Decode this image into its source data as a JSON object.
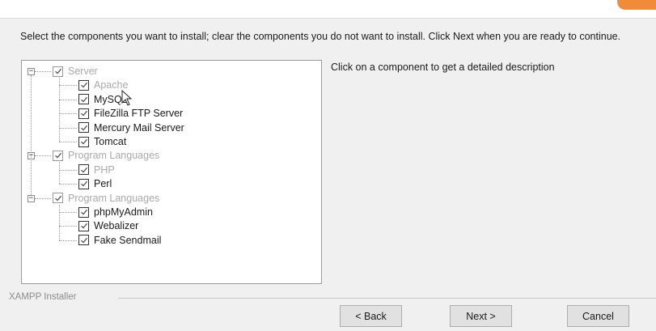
{
  "instructions": "Select the components you want to install; clear the components you do not want to install. Click Next when you are ready to continue.",
  "description": "Click on a component to get a detailed description",
  "tree": [
    {
      "label": "Server",
      "checked": true,
      "dimmed": true,
      "children": [
        {
          "label": "Apache",
          "checked": true,
          "dimmed": true
        },
        {
          "label": "MySQL",
          "checked": true,
          "dimmed": false
        },
        {
          "label": "FileZilla FTP Server",
          "checked": true,
          "dimmed": false
        },
        {
          "label": "Mercury Mail Server",
          "checked": true,
          "dimmed": false
        },
        {
          "label": "Tomcat",
          "checked": true,
          "dimmed": false
        }
      ]
    },
    {
      "label": "Program Languages",
      "checked": true,
      "dimmed": true,
      "children": [
        {
          "label": "PHP",
          "checked": true,
          "dimmed": true
        },
        {
          "label": "Perl",
          "checked": true,
          "dimmed": false
        }
      ]
    },
    {
      "label": "Program Languages",
      "checked": true,
      "dimmed": true,
      "children": [
        {
          "label": "phpMyAdmin",
          "checked": true,
          "dimmed": false
        },
        {
          "label": "Webalizer",
          "checked": true,
          "dimmed": false
        },
        {
          "label": "Fake Sendmail",
          "checked": true,
          "dimmed": false
        }
      ]
    }
  ],
  "footer": {
    "brand": "XAMPP Installer",
    "back_label": "< Back",
    "next_label": "Next >",
    "cancel_label": "Cancel"
  },
  "icons": {
    "checkbox": "checkmark-icon",
    "expander": "collapse-minus-icon",
    "cursor": "mouse-pointer-icon"
  },
  "colors": {
    "accent": "#f08b3a",
    "background": "#f0f0f0",
    "dim_text": "#a9a9a9"
  }
}
